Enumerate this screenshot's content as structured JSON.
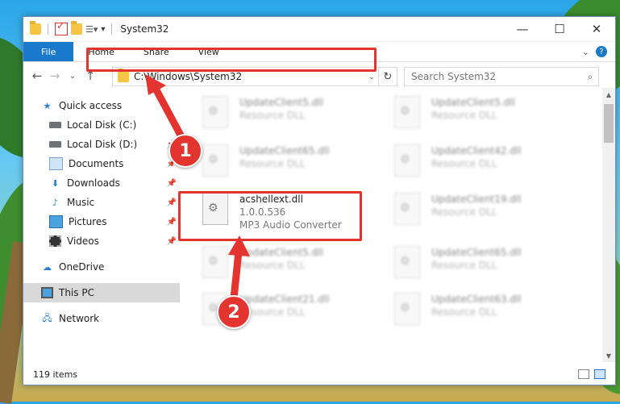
{
  "window": {
    "title": "System32",
    "controls": {
      "minimize": "—",
      "maximize": "☐",
      "close": "✕"
    }
  },
  "ribbon": {
    "tabs": [
      "File",
      "Home",
      "Share",
      "View"
    ],
    "collapse": "⌄",
    "help": "?"
  },
  "nav": {
    "back": "←",
    "forward": "→",
    "recent": "⌄",
    "up": "↑",
    "address": "C:\\Windows\\System32",
    "refresh": "↻",
    "search_placeholder": "Search System32"
  },
  "sidebar": {
    "items": [
      {
        "label": "Quick access",
        "icon": "star-icon"
      },
      {
        "label": "Local Disk (C:)",
        "icon": "disk-icon"
      },
      {
        "label": "Local Disk (D:)",
        "icon": "disk-icon"
      },
      {
        "label": "Documents",
        "icon": "documents-icon"
      },
      {
        "label": "Downloads",
        "icon": "downloads-icon"
      },
      {
        "label": "Music",
        "icon": "music-icon"
      },
      {
        "label": "Pictures",
        "icon": "pictures-icon"
      },
      {
        "label": "Videos",
        "icon": "videos-icon"
      },
      {
        "label": "OneDrive",
        "icon": "cloud-icon"
      },
      {
        "label": "This PC",
        "icon": "pc-icon"
      },
      {
        "label": "Network",
        "icon": "network-icon"
      }
    ]
  },
  "files": {
    "left": [
      {
        "name": "UpdateClient5.dll",
        "type": "Resource DLL"
      },
      {
        "name": "UpdateClient65.dll",
        "type": "Resource DLL"
      },
      {
        "name": "acshellext.dll",
        "version": "1.0.0.536",
        "desc": "MP3 Audio Converter"
      },
      {
        "name": "UpdateClient5.dll",
        "type": "Resource DLL"
      },
      {
        "name": "UpdateClient21.dll",
        "type": "Resource DLL"
      }
    ],
    "right": [
      {
        "name": "UpdateClient5.dll",
        "type": "Resource DLL"
      },
      {
        "name": "UpdateClient42.dll",
        "type": "Resource DLL"
      },
      {
        "name": "UpdateClient19.dll",
        "type": "Resource DLL"
      },
      {
        "name": "UpdateClient65.dll",
        "type": "Resource DLL"
      },
      {
        "name": "UpdateClient63.dll",
        "type": "Resource DLL"
      }
    ]
  },
  "status": {
    "count": "119 items"
  },
  "callouts": [
    "1",
    "2"
  ],
  "colors": {
    "accent": "#1979ca",
    "highlight": "#e3342f"
  }
}
